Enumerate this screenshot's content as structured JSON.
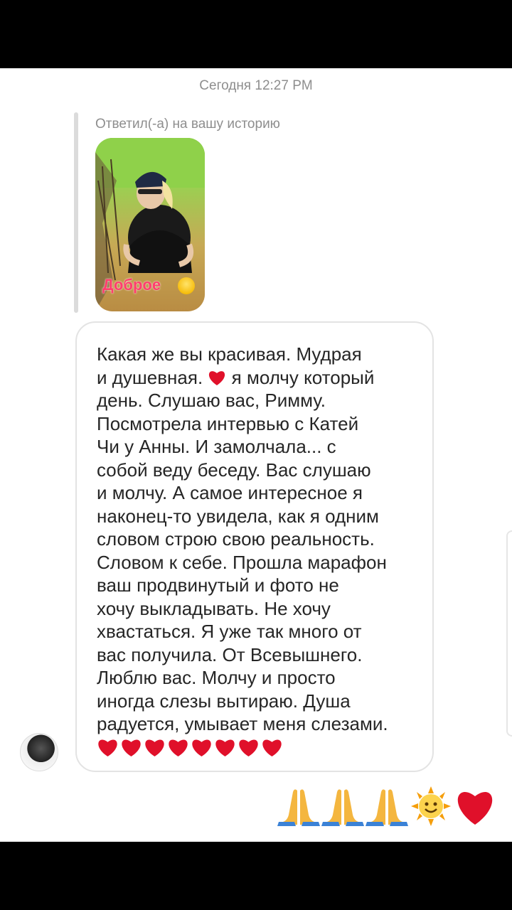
{
  "thread": {
    "timestamp": "Сегодня 12:27 PM",
    "reply_label": "Ответил(-а) на вашу историю",
    "story": {
      "caption": "Доброе",
      "caption_emoji": "smiling-face-emoji"
    },
    "message": {
      "lines": [
        "Какая же вы красивая. Мудрая",
        "и душевная.",
        "я молчу который",
        "день. Слушаю вас, Римму.",
        "Посмотрела интервью с Катей",
        "Чи у Анны. И замолчала... с",
        "собой веду беседу. Вас слушаю",
        "и молчу. А самое интересное я",
        "наконец-то увидела, как я одним",
        "словом строю свою реальность.",
        "Словом к себе. Прошла марафон",
        "ваш продвинутый и фото не",
        "хочу выкладывать. Не хочу",
        "хвастаться. Я уже так много от",
        "вас получила. От Всевышнего.",
        "Люблю вас. Молчу и просто",
        "иногда слезы вытираю. Душа",
        "радуется, умывает меня слезами."
      ],
      "inline_emoji": "red-heart-emoji",
      "trailing_hearts_count": 8
    },
    "sent_reaction_emojis": [
      "folded-hands-emoji",
      "folded-hands-emoji",
      "folded-hands-emoji",
      "sun-with-face-emoji",
      "red-heart-emoji"
    ],
    "colors": {
      "heart": "#e0102a",
      "meta_text": "#8e8e8e",
      "caption": "#ff3f6e"
    }
  }
}
